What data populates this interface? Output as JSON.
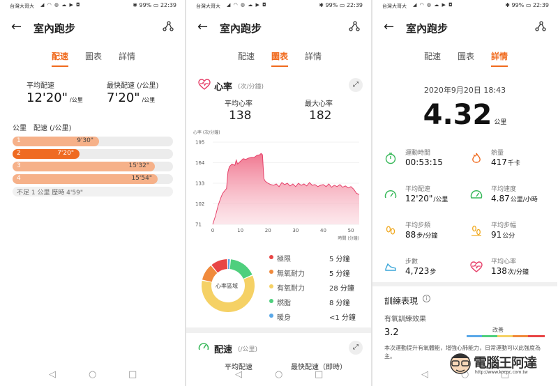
{
  "status": {
    "carrier": "台灣大哥大",
    "icons": "◢ ◠ ◍ ☁ ▶ ◘",
    "battery": "99%",
    "time": "22:39"
  },
  "app": {
    "title": "室內跑步"
  },
  "tabs": [
    "配速",
    "圖表",
    "詳情"
  ],
  "pace_panel": {
    "avg_label": "平均配速",
    "avg_value": "12'20\"",
    "avg_unit": "/公里",
    "max_label": "最快配速 (/公里)",
    "max_value": "7'20\"",
    "max_unit": "/公里",
    "list_header": "公里　配速 (/公里)",
    "rows": [
      {
        "km": "1",
        "pace": "9'30\"",
        "fill": 0.52,
        "fastest": false
      },
      {
        "km": "2",
        "pace": "7'20\"",
        "fill": 0.42,
        "fastest": true
      },
      {
        "km": "3",
        "pace": "15'32\"",
        "fill": 0.88,
        "fastest": false
      },
      {
        "km": "4",
        "pace": "15'54\"",
        "fill": 0.9,
        "fastest": false
      }
    ],
    "footnote": "不足 1 公里 歷時 4'59\""
  },
  "chart_panel": {
    "hr_title": "心率",
    "hr_unit": "(次/分鐘)",
    "avg_hr_label": "平均心率",
    "avg_hr_value": "138",
    "max_hr_label": "最大心率",
    "max_hr_value": "182",
    "zone_center": "心率區域",
    "zones": [
      {
        "name": "極限",
        "value": "5 分鐘",
        "color": "#e84545",
        "minutes": 5
      },
      {
        "name": "無氧耐力",
        "value": "5 分鐘",
        "color": "#f08a3c",
        "minutes": 5
      },
      {
        "name": "有氧耐力",
        "value": "28 分鐘",
        "color": "#f5d165",
        "minutes": 28
      },
      {
        "name": "燃脂",
        "value": "8 分鐘",
        "color": "#4fcf7d",
        "minutes": 8
      },
      {
        "name": "暖身",
        "value": "<1 分鐘",
        "color": "#5aa8e8",
        "minutes": 0.8
      }
    ],
    "pace_title": "配速",
    "pace_unit": "(/公里)",
    "pace_avg_label": "平均配速",
    "pace_max_label": "最快配速（即時）"
  },
  "chart_data": {
    "type": "area",
    "title": "",
    "ylabel": "心率 (次/分鐘)",
    "xlabel": "時間 (分鐘)",
    "yticks": [
      71,
      102,
      133,
      164,
      195
    ],
    "xticks": [
      0,
      10,
      20,
      30,
      40,
      50
    ],
    "ylim": [
      71,
      195
    ],
    "xlim": [
      0,
      53
    ],
    "grid": true,
    "series": [
      {
        "x": [
          0,
          1,
          2,
          3,
          3.5,
          4,
          5,
          5.5,
          6,
          7,
          8,
          8.5,
          9,
          10,
          11,
          12,
          13,
          14,
          15,
          16,
          17,
          17.5,
          18,
          18.5,
          19,
          20,
          21,
          22,
          23,
          24,
          25,
          26,
          27,
          28,
          29,
          30,
          31,
          32,
          33,
          34,
          35,
          36,
          37,
          38,
          39,
          40,
          41,
          42,
          43,
          44,
          45,
          46,
          47,
          48,
          49,
          50,
          51,
          52,
          53
        ],
        "y": [
          71,
          84,
          100,
          112,
          117,
          120,
          125,
          150,
          158,
          162,
          160,
          168,
          162,
          166,
          170,
          169,
          171,
          172,
          172,
          175,
          176,
          178,
          176,
          140,
          136,
          133,
          131,
          130,
          132,
          128,
          134,
          131,
          133,
          129,
          132,
          128,
          133,
          130,
          132,
          129,
          134,
          130,
          131,
          128,
          130,
          131,
          128,
          132,
          127,
          130,
          128,
          131,
          127,
          129,
          126,
          128,
          124,
          118,
          116
        ]
      }
    ]
  },
  "detail_panel": {
    "datetime": "2020年9月20日 18:43",
    "distance": "4.32",
    "distance_unit": "公里",
    "metrics": [
      {
        "label": "運動時間",
        "value": "00:53:15",
        "unit": "",
        "icon": "stopwatch-icon"
      },
      {
        "label": "熱量",
        "value": "417",
        "unit": "千卡",
        "icon": "flame-icon"
      },
      {
        "label": "平均配速",
        "value": "12'20\"",
        "unit": "/公里",
        "icon": "speedometer-icon"
      },
      {
        "label": "平均速度",
        "value": "4.87",
        "unit": "公里/小時",
        "icon": "speed-gauge-icon"
      },
      {
        "label": "平均步頻",
        "value": "88",
        "unit": "步/分鐘",
        "icon": "footprints-icon"
      },
      {
        "label": "平均步幅",
        "value": "91",
        "unit": "公分",
        "icon": "stride-icon"
      },
      {
        "label": "步數",
        "value": "4,723",
        "unit": "步",
        "icon": "shoe-icon"
      },
      {
        "label": "平均心率",
        "value": "138",
        "unit": "次/分鐘",
        "icon": "heart-rate-icon"
      }
    ],
    "training_title": "訓練表現",
    "aerobic_label": "有氧訓練效果",
    "aerobic_value": "3.2",
    "scale_label": "改善",
    "description": "本次運動提升有氧體能，增強心肺能力，日常運動可以此強度為主。"
  },
  "watermark": "電腦王阿達",
  "watermark_url": "http://www.kocpc.com.tw"
}
